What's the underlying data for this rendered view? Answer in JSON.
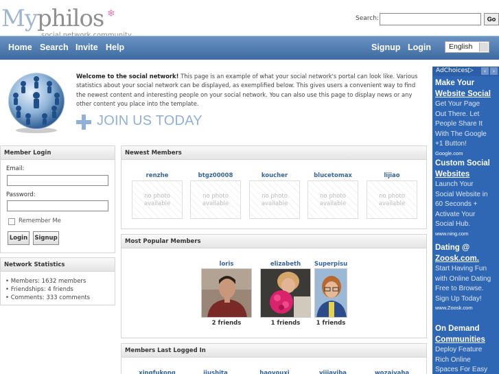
{
  "header": {
    "logo_my": "My",
    "logo_philos": "philos",
    "logo_tagline": "social network community",
    "search_label": "Search:",
    "search_value": "",
    "go_label": "Go"
  },
  "nav": {
    "items": [
      "Home",
      "Search",
      "Invite",
      "Help"
    ],
    "signup": "Signup",
    "login": "Login",
    "language": "English"
  },
  "welcome": {
    "bold": "Welcome to the social network!",
    "text": " This page is an example of what your social network's portal can look like. Various statistics about your social network can be displayed, as exemplified below. This gives users a convenient way to find the newest content and interesting people on your social network. You can also use this page to display news or any other content you place into the template.",
    "join": "JOIN US TODAY"
  },
  "login_box": {
    "title": "Member Login",
    "email_label": "Email:",
    "password_label": "Password:",
    "remember": "Remember Me",
    "login_button": "Login",
    "signup_button": "Signup"
  },
  "stats_box": {
    "title": "Network Statistics",
    "members": "• Members: 1632 members",
    "friendships": "• Friendships: 4 friends",
    "comments": "• Comments: 333 comments"
  },
  "newest": {
    "title": "Newest Members",
    "members": [
      "renzhe",
      "btgz00008",
      "koucher",
      "blucetomax",
      "lijiao"
    ],
    "no_photo": "no photo available"
  },
  "popular": {
    "title": "Most Popular Members",
    "members": [
      {
        "name": "loris",
        "friends": "2 friends"
      },
      {
        "name": "elizabeth",
        "friends": "1 friends"
      },
      {
        "name": "Superpisu",
        "friends": "1 friends"
      }
    ]
  },
  "last_logged": {
    "title": "Members Last Logged In",
    "members": [
      "xingfukong",
      "jiushita",
      "haoyouxi",
      "yijiayiba",
      "wozaiyaha"
    ]
  },
  "ads": {
    "adchoices": "AdChoices",
    "items": [
      {
        "title1": "Make Your",
        "title2": "Website Social",
        "desc": [
          "Get Your Page",
          "Out There. Let",
          "People Share It",
          "With The Google",
          "+1 Button!"
        ],
        "url": "Google.com"
      },
      {
        "title1": "Custom Social",
        "title2": "Websites",
        "desc": [
          "Launch Your",
          "Social Website in",
          "60 Seconds +",
          "Activate Your",
          "Social Hub."
        ],
        "url": "www.ning.com"
      },
      {
        "title1": "Dating @",
        "title2": "Zoosk.com.",
        "desc": [
          "Start Having Fun",
          "with Online Dating",
          "Free to Browse.",
          "Sign Up Today!"
        ],
        "url": "www.Zoosk.com"
      },
      {
        "title1": "On Demand",
        "title2": "Communities",
        "desc": [
          "Deploy Feature",
          "Rich Online",
          "Spaces For Easy"
        ],
        "url": ""
      }
    ]
  }
}
